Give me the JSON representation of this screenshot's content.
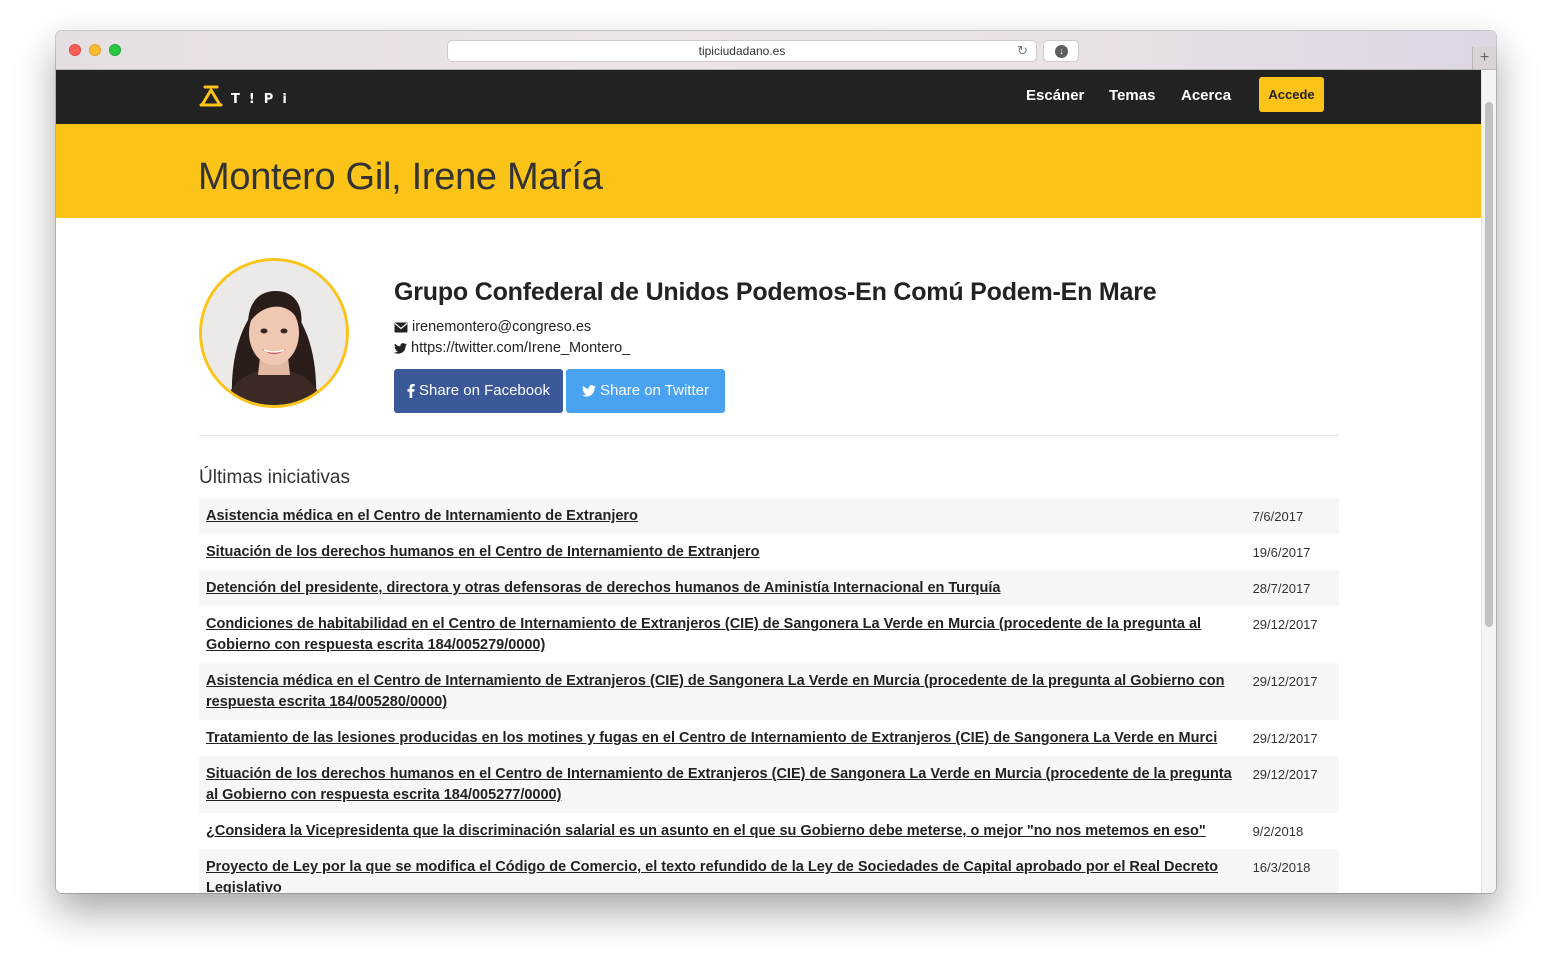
{
  "browser": {
    "url": "tipiciudadano.es"
  },
  "nav": {
    "logo_text": "T!Pi",
    "links": [
      "Escáner",
      "Temas",
      "Acerca"
    ],
    "cta": "Accede"
  },
  "colors": {
    "accent": "#fcc419",
    "navbar": "#222222",
    "facebook": "#3b5998",
    "twitter": "#4aa3f0"
  },
  "profile": {
    "name": "Montero Gil, Irene María",
    "group": "Grupo Confederal de Unidos Podemos-En Comú Podem-En Mare",
    "email": "irenemontero@congreso.es",
    "twitter": "https://twitter.com/Irene_Montero_",
    "share_facebook": "Share on Facebook",
    "share_twitter": "Share on Twitter"
  },
  "initiatives": {
    "heading": "Últimas iniciativas",
    "rows": [
      {
        "title": "Asistencia médica en el Centro de Internamiento de Extranjero",
        "date": "7/6/2017"
      },
      {
        "title": "Situación de los derechos humanos en el Centro de Internamiento de Extranjero",
        "date": "19/6/2017"
      },
      {
        "title": "Detención del presidente, directora y otras defensoras de derechos humanos de Aministía Internacional en Turquía",
        "date": "28/7/2017"
      },
      {
        "title": "Condiciones de habitabilidad en el Centro de Internamiento de Extranjeros (CIE) de Sangonera La Verde en Murcia (procedente de la pregunta al Gobierno con respuesta escrita 184/005279/0000)",
        "date": "29/12/2017"
      },
      {
        "title": "Asistencia médica en el Centro de Internamiento de Extranjeros (CIE) de Sangonera La Verde en Murcia (procedente de la pregunta al Gobierno con respuesta escrita 184/005280/0000)",
        "date": "29/12/2017"
      },
      {
        "title": "Tratamiento de las lesiones producidas en los motines y fugas en el Centro de Internamiento de Extranjeros (CIE) de Sangonera La Verde en Murci",
        "date": "29/12/2017"
      },
      {
        "title": "Situación de los derechos humanos en el Centro de Internamiento de Extranjeros (CIE) de Sangonera La Verde en Murcia (procedente de la pregunta al Gobierno con respuesta escrita 184/005277/0000)",
        "date": "29/12/2017"
      },
      {
        "title": "¿Considera la Vicepresidenta que la discriminación salarial es un asunto en el que su Gobierno debe meterse, o mejor \"no nos metemos en eso\"",
        "date": "9/2/2018"
      },
      {
        "title": "Proyecto de Ley por la que se modifica el Código de Comercio, el texto refundido de la Ley de Sociedades de Capital aprobado por el Real Decreto Legislativo",
        "date": "16/3/2018"
      }
    ]
  }
}
